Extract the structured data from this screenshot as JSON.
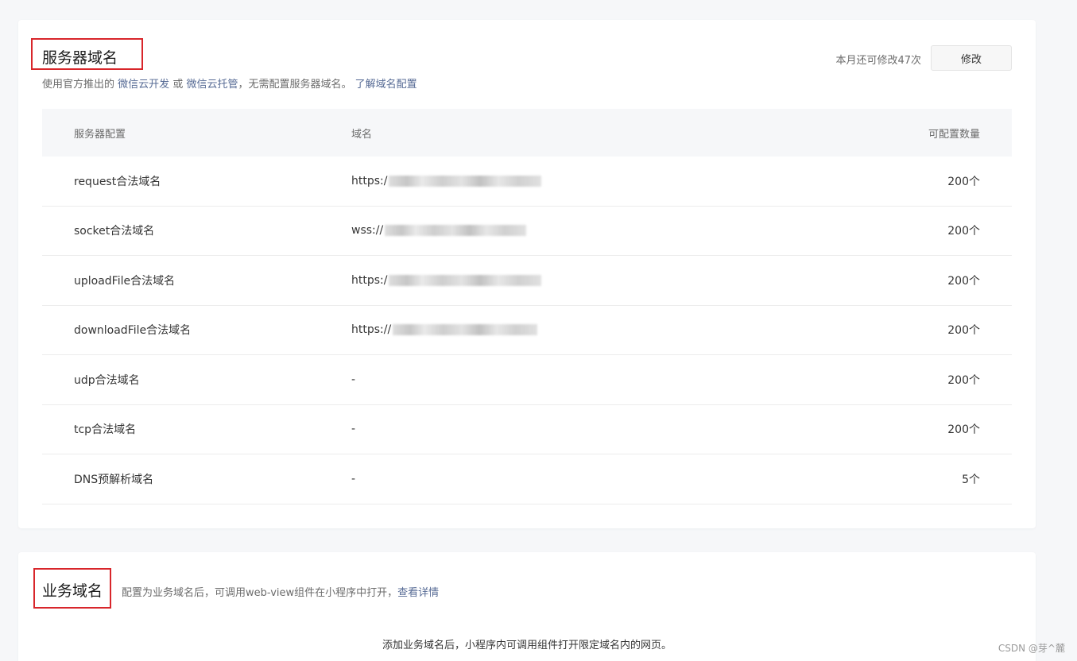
{
  "server": {
    "title": "服务器域名",
    "desc_prefix": "使用官方推出的",
    "desc_link1": "微信云开发",
    "desc_or": "或",
    "desc_link2": "微信云托管",
    "desc_middle": "，无需配置服务器域名。",
    "desc_link3": "了解域名配置",
    "quota_text": "本月还可修改47次",
    "edit_label": "修改",
    "columns": [
      "服务器配置",
      "域名",
      "可配置数量"
    ],
    "rows": [
      {
        "name": "request合法域名",
        "domain": "https:/",
        "count": "200个"
      },
      {
        "name": "socket合法域名",
        "domain": "wss://",
        "count": "200个"
      },
      {
        "name": "uploadFile合法域名",
        "domain": "https:/",
        "count": "200个"
      },
      {
        "name": "downloadFile合法域名",
        "domain": "https://",
        "count": "200个"
      },
      {
        "name": "udp合法域名",
        "domain": "-",
        "count": "200个"
      },
      {
        "name": "tcp合法域名",
        "domain": "-",
        "count": "200个"
      },
      {
        "name": "DNS预解析域名",
        "domain": "-",
        "count": "5个"
      }
    ]
  },
  "business": {
    "title": "业务域名",
    "desc": "配置为业务域名后，可调用web-view组件在小程序中打开，",
    "desc_link": "查看详情",
    "hint": "添加业务域名后，小程序内可调用组件打开限定域名内的网页。"
  },
  "watermark": "CSDN @芽^麓"
}
